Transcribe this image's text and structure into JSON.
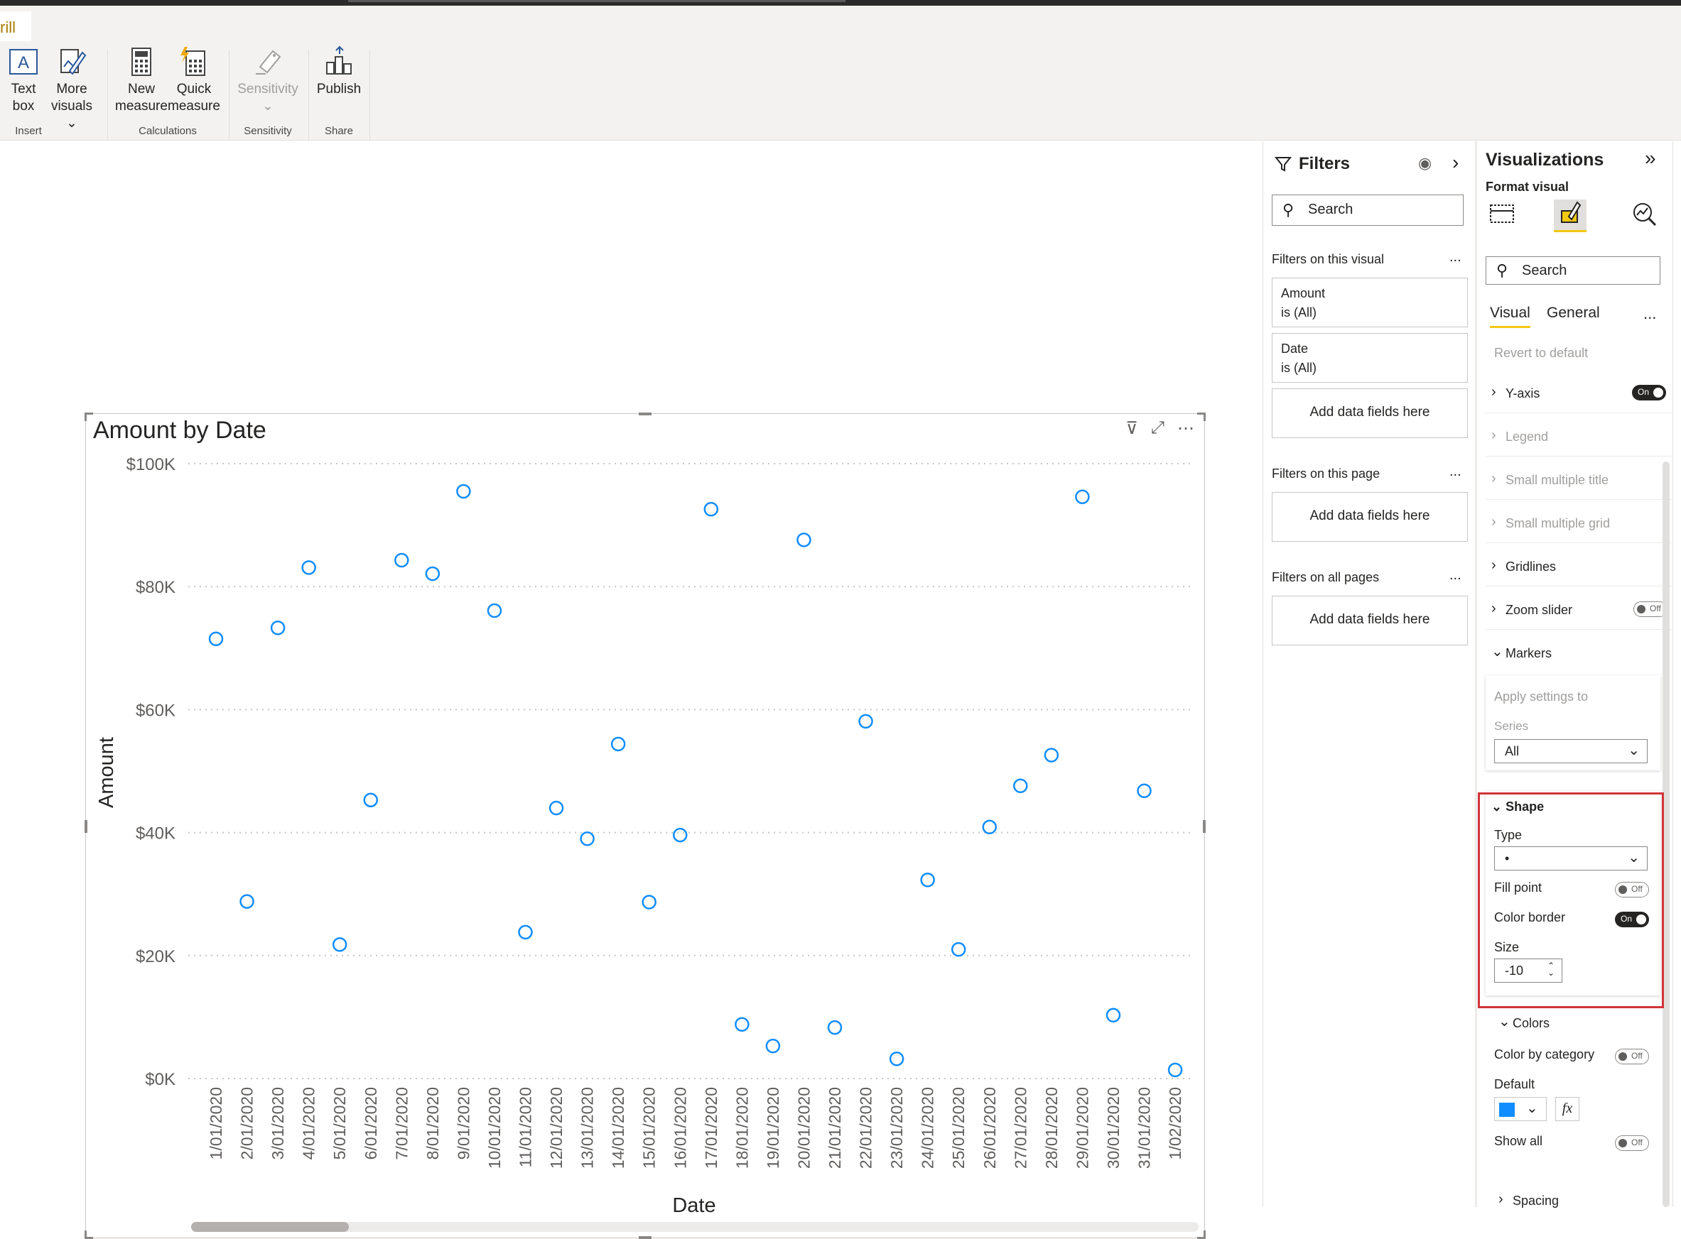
{
  "ribbon": {
    "tab_label": "rill",
    "buttons": [
      {
        "id": "text-box",
        "label1": "Text",
        "label2": "box"
      },
      {
        "id": "more-visuals",
        "label1": "More",
        "label2": "visuals ⌄"
      },
      {
        "id": "new-measure",
        "label1": "New",
        "label2": "measure"
      },
      {
        "id": "quick-measure",
        "label1": "Quick",
        "label2": "measure"
      },
      {
        "id": "sensitivity",
        "label1": "Sensitivity",
        "label2": "⌄"
      },
      {
        "id": "publish",
        "label1": "Publish",
        "label2": ""
      }
    ],
    "groups": {
      "insert": "Insert",
      "calculations": "Calculations",
      "sensitivity": "Sensitivity",
      "share": "Share"
    }
  },
  "visual": {
    "title": "Amount by Date",
    "xlabel": "Date",
    "ylabel": "Amount"
  },
  "chart_data": {
    "type": "scatter",
    "title": "Amount by Date",
    "xlabel": "Date",
    "ylabel": "Amount",
    "ylim": [
      0,
      100000
    ],
    "yticks": [
      "$0K",
      "$20K",
      "$40K",
      "$60K",
      "$80K",
      "$100K"
    ],
    "ytick_values": [
      0,
      20000,
      40000,
      60000,
      80000,
      100000
    ],
    "grid": "horizontal dotted",
    "marker": "hollow circle",
    "marker_color": "#118DFF",
    "categories": [
      "1/01/2020",
      "2/01/2020",
      "3/01/2020",
      "4/01/2020",
      "5/01/2020",
      "6/01/2020",
      "7/01/2020",
      "8/01/2020",
      "9/01/2020",
      "10/01/2020",
      "11/01/2020",
      "12/01/2020",
      "13/01/2020",
      "14/01/2020",
      "15/01/2020",
      "16/01/2020",
      "17/01/2020",
      "18/01/2020",
      "19/01/2020",
      "20/01/2020",
      "21/01/2020",
      "22/01/2020",
      "23/01/2020",
      "24/01/2020",
      "25/01/2020",
      "26/01/2020",
      "27/01/2020",
      "28/01/2020",
      "29/01/2020",
      "30/01/2020",
      "31/01/2020",
      "1/02/2020"
    ],
    "values": [
      71500,
      28800,
      73300,
      83100,
      21800,
      45300,
      84300,
      82100,
      95500,
      76100,
      23800,
      44000,
      39000,
      54400,
      28700,
      39600,
      92600,
      8800,
      5300,
      87600,
      8300,
      58100,
      3200,
      32300,
      21000,
      40900,
      47600,
      52600,
      94600,
      10300,
      46800,
      1400
    ]
  },
  "filters": {
    "title": "Filters",
    "search_placeholder": "Search",
    "on_visual": "Filters on this visual",
    "on_page": "Filters on this page",
    "on_all_pages": "Filters on all pages",
    "dots": "...",
    "cards": [
      {
        "field": "Amount",
        "state": "is (All)"
      },
      {
        "field": "Date",
        "state": "is (All)"
      }
    ],
    "add_fields": "Add data fields here"
  },
  "viz": {
    "title": "Visualizations",
    "subtitle": "Format visual",
    "search_placeholder": "Search",
    "tab_visual": "Visual",
    "tab_general": "General",
    "dots": "...",
    "revert": "Revert to default",
    "sections": [
      {
        "label": "Y-axis",
        "toggle": "On",
        "disabled": false
      },
      {
        "label": "Legend",
        "toggle": "",
        "disabled": true
      },
      {
        "label": "Small multiple title",
        "toggle": "",
        "disabled": true
      },
      {
        "label": "Small multiple grid",
        "toggle": "",
        "disabled": true
      },
      {
        "label": "Gridlines",
        "toggle": "",
        "disabled": false
      },
      {
        "label": "Zoom slider",
        "toggle": "Off",
        "disabled": false
      }
    ],
    "markers": {
      "label": "Markers",
      "apply_to": "Apply settings to",
      "series_label": "Series",
      "series_value": "All"
    },
    "shape": {
      "label": "Shape",
      "type_label": "Type",
      "type_value": "•",
      "fill_point": "Fill point",
      "fill_point_toggle": "Off",
      "color_border": "Color border",
      "color_border_toggle": "On",
      "size_label": "Size",
      "size_value": "-10"
    },
    "colors": {
      "label": "Colors",
      "by_category": "Color by category",
      "by_category_toggle": "Off",
      "default_label": "Default",
      "default_color": "#118DFF",
      "fx": "fx",
      "show_all": "Show all",
      "show_all_toggle": "Off"
    },
    "spacing": "Spacing"
  }
}
